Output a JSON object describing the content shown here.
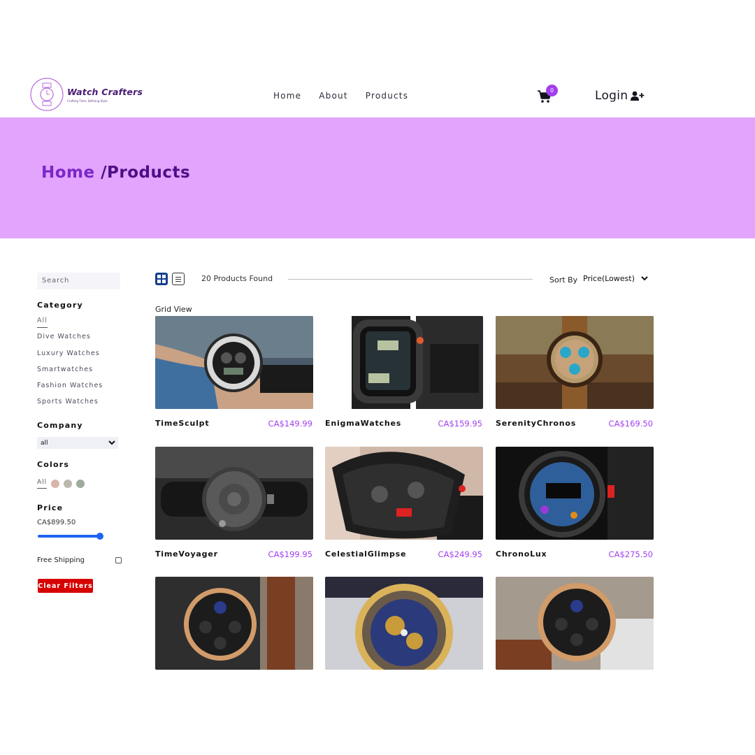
{
  "brand": {
    "name": "Watch Crafters",
    "tagline": "Crafting Time, Defining Style"
  },
  "nav": {
    "items": [
      "Home",
      "About",
      "Products"
    ]
  },
  "cart": {
    "count": "0"
  },
  "auth": {
    "login_label": "Login"
  },
  "hero": {
    "home": "Home",
    "current": "/Products"
  },
  "sidebar": {
    "search_placeholder": "Search",
    "category_title": "Category",
    "categories": [
      "All",
      "Dive Watches",
      "Luxury Watches",
      "Smartwatches",
      "Fashion Watches",
      "Sports Watches"
    ],
    "company_title": "Company",
    "company_value": "all",
    "colors_title": "Colors",
    "colors_all": "All",
    "colors": [
      "#d7b5a9",
      "#bdb7ae",
      "#9dab9a"
    ],
    "price_title": "Price",
    "price_value": "CA$899.50",
    "price_fraction": 0.98,
    "free_shipping": "Free Shipping",
    "free_shipping_checked": false,
    "clear_filters": "Clear Filters"
  },
  "toolbar": {
    "found": "20 Products Found",
    "sort_label": "Sort By",
    "sort_value": "Price(Lowest)",
    "view_caption": "Grid View"
  },
  "products": [
    {
      "name": "TimeSculpt",
      "price": "CA$149.99",
      "image": "silver-digital-watch-on-wrist"
    },
    {
      "name": "EnigmaWatches",
      "price": "CA$159.95",
      "image": "rugged-smartwatch"
    },
    {
      "name": "SerenityChronos",
      "price": "CA$169.50",
      "image": "wooden-blue-chronograph"
    },
    {
      "name": "TimeVoyager",
      "price": "CA$199.95",
      "image": "magnetic-ball-watch"
    },
    {
      "name": "CelestialGlimpse",
      "price": "CA$249.95",
      "image": "skeleton-sport-watch"
    },
    {
      "name": "ChronoLux",
      "price": "CA$275.50",
      "image": "smartwatch-blue-dial"
    },
    {
      "name": "",
      "price": "",
      "image": "rose-gold-chronograph"
    },
    {
      "name": "",
      "price": "",
      "image": "gold-skeleton-watch"
    },
    {
      "name": "",
      "price": "",
      "image": "rose-gold-black-dial"
    }
  ],
  "colors": {
    "accent": "#a23ff0",
    "hero_bg": "#e2a4fd",
    "crumb_home": "#7b27c9",
    "crumb_current": "#4c0f86",
    "danger": "#d60000",
    "slider": "#1c64f2"
  }
}
